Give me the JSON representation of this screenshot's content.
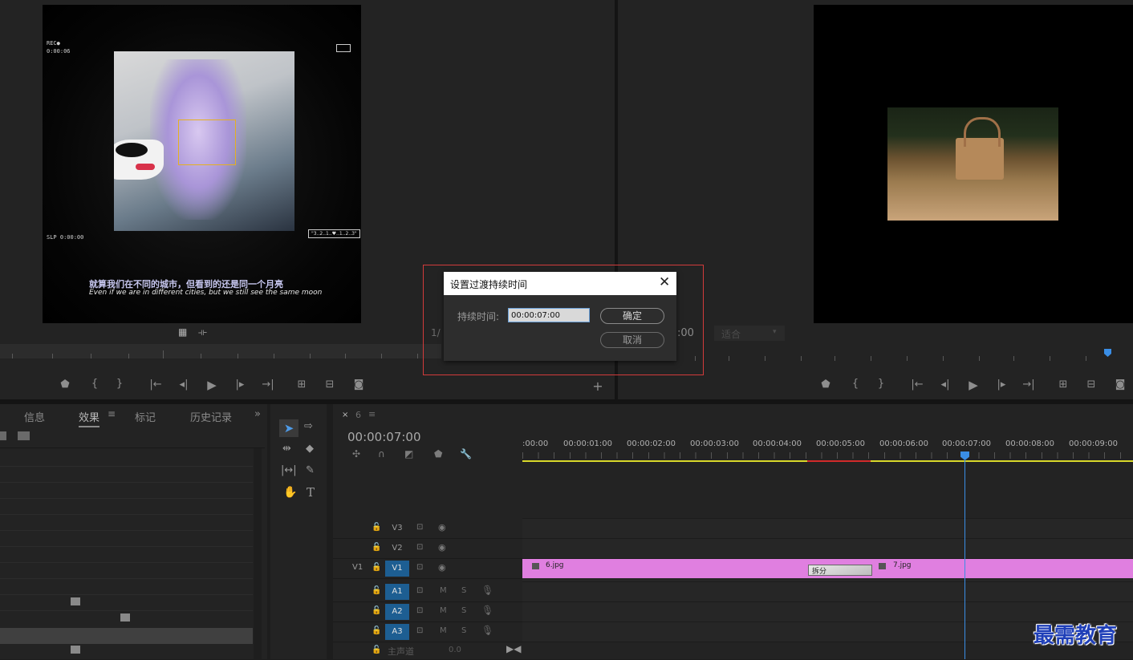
{
  "source_monitor": {
    "overlay_rec": "REC●",
    "overlay_rec_time": "0:00:06",
    "overlay_slp": "SLP 0:00:00",
    "overlay_counter": "\"3..2..1..♥..1..2..3\"",
    "subtitle_cn": "就算我们在不同的城市，但看到的还是同一个月亮",
    "subtitle_en": "Even if we are in different cities, but we still see the same moon",
    "partial_left": "1/"
  },
  "program_monitor": {
    "partial_timecode": ":00",
    "fit_label": "适合"
  },
  "dialog": {
    "title": "设置过渡持续时间",
    "duration_label": "持续时间:",
    "duration_value": "00:00:07:00",
    "ok_label": "确定",
    "cancel_label": "取消"
  },
  "effects_panel": {
    "tabs": [
      "信息",
      "效果",
      "标记",
      "历史记录"
    ],
    "active_tab": "效果"
  },
  "timeline": {
    "sequence_name": "6",
    "timecode": "00:00:07:00",
    "time_labels": [
      ":00:00",
      "00:00:01:00",
      "00:00:02:00",
      "00:00:03:00",
      "00:00:04:00",
      "00:00:05:00",
      "00:00:06:00",
      "00:00:07:00",
      "00:00:08:00",
      "00:00:09:00"
    ],
    "video_tracks": [
      "V3",
      "V2",
      "V1"
    ],
    "audio_tracks": [
      "A1",
      "A2",
      "A3"
    ],
    "source_patch": "V1",
    "master_label": "主声道",
    "master_value": "0.0",
    "clip_a": "6.jpg",
    "clip_b": "7.jpg",
    "transition_label": "拆分",
    "mute_label": "M",
    "solo_label": "S"
  },
  "watermark": "最需教育",
  "colors": {
    "clip": "#e07fe0",
    "playhead": "#3a8ee6",
    "track_on": "#1d5e92",
    "dialog_border": "#d23b3b"
  }
}
